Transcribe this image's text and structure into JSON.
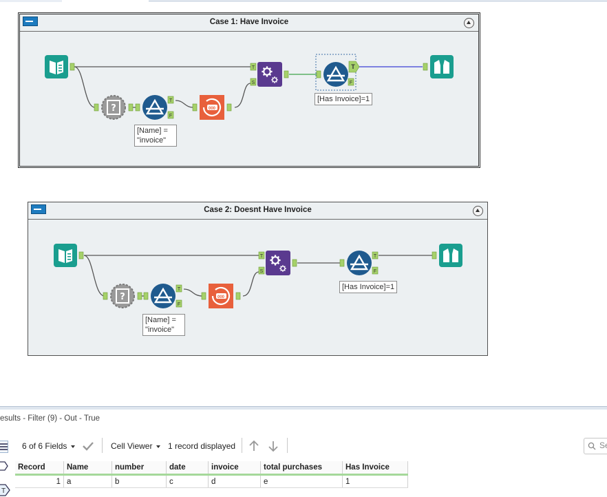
{
  "containers": [
    {
      "title": "Case 1: Have Invoice",
      "filter1_expr_line1": "[Name] =",
      "filter1_expr_line2": "\"invoice\"",
      "filter2_expr": "[Has Invoice]=1"
    },
    {
      "title": "Case 2: Doesnt Have Invoice",
      "filter1_expr_line1": "[Name] =",
      "filter1_expr_line2": "\"invoice\"",
      "filter2_expr": "[Has Invoice]=1"
    }
  ],
  "anchors": {
    "t": "T",
    "f": "F",
    "s": "S"
  },
  "results": {
    "title": "esults - Filter (9) - Out - True",
    "fields_label": "6 of 6 Fields",
    "viewer_label": "Cell Viewer",
    "records_label": "1 record displayed",
    "search_placeholder": "Se",
    "columns": [
      "Record",
      "Name",
      "number",
      "date",
      "invoice",
      "total purchases",
      "Has Invoice"
    ],
    "rows": [
      [
        "1",
        "a",
        "b",
        "c",
        "d",
        "e",
        "1"
      ]
    ]
  },
  "colors": {
    "input_teal": "#1a9e8f",
    "filter_blue": "#1f5a8e",
    "append_purple": "#5a3a8f",
    "record_id_orange": "#e8603c",
    "anchor_green": "#a6d16a",
    "container_bg": "#ecf0f2"
  }
}
